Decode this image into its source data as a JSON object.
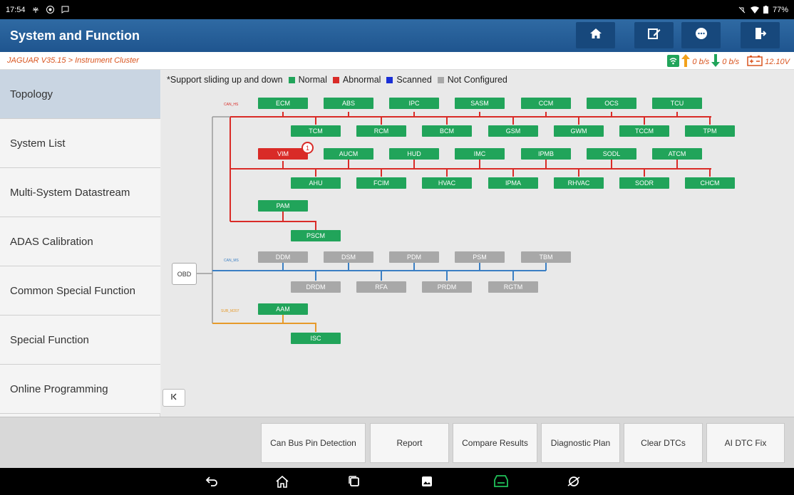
{
  "status": {
    "time": "17:54",
    "battery": "77%"
  },
  "titlebar": {
    "title": "System and Function",
    "home_icon": "home-icon",
    "edit_icon": "edit-icon",
    "chat_icon": "chat-icon",
    "exit_icon": "exit-icon"
  },
  "breadcrumb": {
    "text": "JAGUAR V35.15 > Instrument Cluster",
    "up_rate": "0 b/s",
    "down_rate": "0 b/s",
    "voltage": "12.10V"
  },
  "sidebar": {
    "items": [
      {
        "label": "Topology",
        "active": true
      },
      {
        "label": "System List"
      },
      {
        "label": "Multi-System Datastream"
      },
      {
        "label": "ADAS Calibration"
      },
      {
        "label": "Common Special Function"
      },
      {
        "label": "Special Function"
      },
      {
        "label": "Online Programming"
      }
    ]
  },
  "legend": {
    "note": "*Support sliding up and down",
    "normal": "Normal",
    "abnormal": "Abnormal",
    "scanned": "Scanned",
    "not_configured": "Not Configured",
    "colors": {
      "normal": "#21a45a",
      "abnormal": "#d92b27",
      "scanned": "#1a2fd6",
      "not_configured": "#a8a8a8"
    }
  },
  "topology": {
    "obd": "OBD",
    "badge": "1",
    "buses": [
      {
        "label": "CAN_HS",
        "color": "#d92b27"
      },
      {
        "label": "CAN_MS",
        "color": "#3a7fc4"
      },
      {
        "label": "SUB_M207",
        "color": "#e69a2a"
      }
    ],
    "modules": [
      "ECM",
      "ABS",
      "IPC",
      "SASM",
      "CCM",
      "OCS",
      "TCU",
      "TCM",
      "RCM",
      "BCM",
      "GSM",
      "GWM",
      "TCCM",
      "TPM",
      "VIM",
      "AUCM",
      "HUD",
      "IMC",
      "IPMB",
      "SODL",
      "ATCM",
      "AHU",
      "FCIM",
      "HVAC",
      "IPMA",
      "RHVAC",
      "SODR",
      "CHCM",
      "PAM",
      "PSCM",
      "DDM",
      "DSM",
      "PDM",
      "PSM",
      "TBM",
      "DRDM",
      "RFA",
      "PRDM",
      "RGTM",
      "AAM",
      "ISC"
    ]
  },
  "collapse_icon": "collapse-left-icon",
  "bottom_buttons": [
    "Can Bus Pin Detection",
    "Report",
    "Compare Results",
    "Diagnostic Plan",
    "Clear DTCs",
    "AI DTC Fix"
  ],
  "navbar_icons": [
    "back-icon",
    "home-outline-icon",
    "recents-icon",
    "gallery-icon",
    "vci-icon",
    "browser-icon"
  ]
}
